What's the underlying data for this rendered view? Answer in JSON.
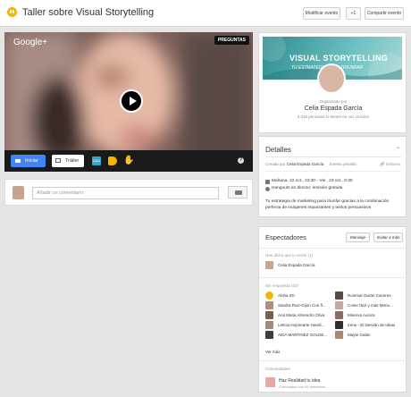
{
  "header": {
    "title": "Taller sobre Visual Storytelling",
    "modify_label": "Modificar evento",
    "plus_one_label": "+1",
    "share_label": "Compartir evento"
  },
  "video": {
    "brand": "Google+",
    "questions_badge": "PREGUNTAS",
    "start_label": "Iniciar",
    "trailer_label": "Tráiler",
    "qa_label": "Q&A",
    "help_label": "?"
  },
  "comment": {
    "placeholder": "Añadir un comentario"
  },
  "event": {
    "banner_title": "VISUAL STORYTELLING",
    "banner_subtitle": "TU ESTRATEGIA PARA TRIUNFAR",
    "organizer_label": "Organizado por",
    "organizer_name": "Celia Espada García",
    "interest_count": "3.316 personas lo tienen en sus círculos"
  },
  "details": {
    "heading": "Detalles",
    "created_by_prefix": "Creado por",
    "created_by_name": "Celia Espada García",
    "privacy": "Evento privado",
    "links_label": "Enlaces",
    "datetime": "Mañana, 22 oct., 23:30 - Vie., 23 oct., 0:30",
    "location": "Hangouts en directo: emisión gratuita",
    "description": "Tu estrategia de marketing para triunfar gracias a la combinación perfecta de imágenes impactantes y textos persuasivos"
  },
  "spectators": {
    "heading": "Espectadores",
    "message_label": "Mensaje",
    "invite_label": "Invitar a más",
    "said_going_label": "Han dicho que lo verán (1)",
    "going": [
      "Celia Espada García"
    ],
    "no_reply_label": "Sin respuesta (43)",
    "no_reply_left": [
      "Aloha ZD",
      "Sandra Ruiz-Gijon Con fl...",
      "Ana Maria Almendro Oliva",
      "Leticia Inspirearte Handi...",
      "AIDA MARTINEZ GOLDE..."
    ],
    "no_reply_right": [
      "Roinmar Duran Caceres",
      "Coser fácil y más Menu...",
      "Minerva Aurora",
      "Irene - El Desván de Ideas",
      "Mayte Galán"
    ],
    "see_more": "Ver más",
    "community_label": "Comunidades",
    "community_name": "Haz Realidad tu idea",
    "community_members": "Comunidad con 48 miembros"
  },
  "colors": {
    "accent": "#4285f4",
    "hangouts_yellow": "#f4b400"
  }
}
